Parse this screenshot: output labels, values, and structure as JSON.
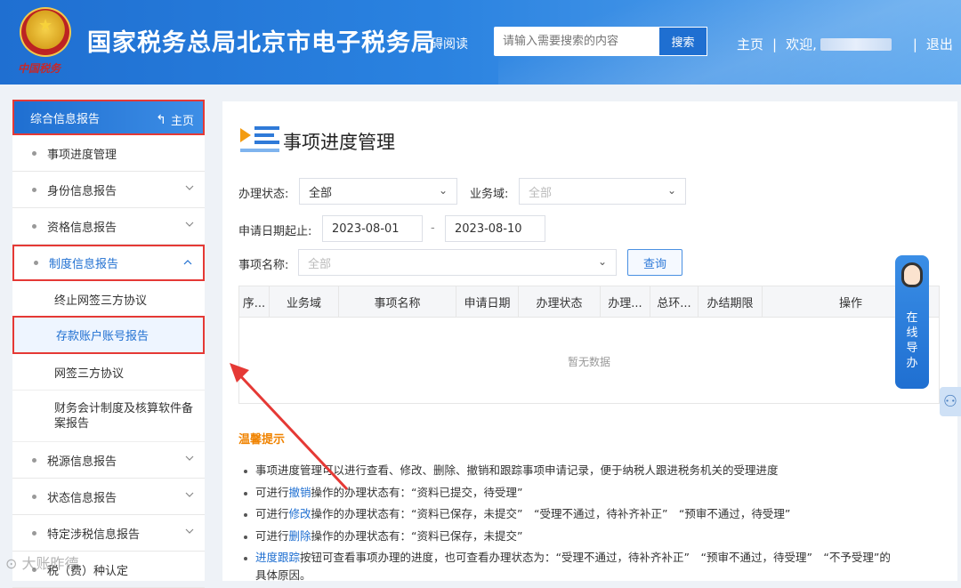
{
  "header": {
    "site_title": "国家税务总局北京市电子税务局",
    "emblem_caption": "中国税务",
    "accessibility": "碍阅读",
    "search_placeholder": "请输入需要搜索的内容",
    "search_button": "搜索",
    "nav_home": "主页",
    "sep1": "|",
    "nav_welcome": "欢迎,",
    "sep2": "|",
    "nav_logout": "退出"
  },
  "sidebar": {
    "top_label": "综合信息报告",
    "top_home": "主页",
    "items": [
      {
        "label": "事项进度管理"
      },
      {
        "label": "身份信息报告"
      },
      {
        "label": "资格信息报告"
      },
      {
        "label": "制度信息报告"
      },
      {
        "label": "税源信息报告"
      },
      {
        "label": "状态信息报告"
      },
      {
        "label": "特定涉税信息报告"
      },
      {
        "label": "税（费）种认定"
      }
    ],
    "sub_items": [
      {
        "label": "终止网签三方协议"
      },
      {
        "label": "存款账户账号报告"
      },
      {
        "label": "网签三方协议"
      },
      {
        "label": "财务会计制度及核算软件备案报告"
      }
    ]
  },
  "main": {
    "title": "事项进度管理",
    "status_label": "办理状态:",
    "status_value": "全部",
    "domain_label": "业务域:",
    "domain_placeholder": "全部",
    "date_label": "申请日期起止:",
    "date_start": "2023-08-01",
    "date_dash": "-",
    "date_end": "2023-08-10",
    "item_label": "事项名称:",
    "item_placeholder": "全部",
    "query_button": "查询",
    "table_headers": [
      "序...",
      "业务域",
      "事项名称",
      "申请日期",
      "办理状态",
      "办理...",
      "总环...",
      "办结期限",
      "操作"
    ],
    "empty_text": "暂无数据",
    "tips_title": "温馨提示",
    "tips": {
      "t1": "事项进度管理可以进行查看、修改、删除、撤销和跟踪事项申请记录，便于纳税人跟进税务机关的受理进度",
      "t2_pre": "可进行",
      "t2_link": "撤销",
      "t2_post": "操作的办理状态有：“资料已提交，待受理”",
      "t3_pre": "可进行",
      "t3_link": "修改",
      "t3_post": "操作的办理状态有：“资料已保存，未提交”　“受理不通过，待补齐补正”　“预审不通过，待受理”",
      "t4_pre": "可进行",
      "t4_link": "删除",
      "t4_post": "操作的办理状态有：“资料已保存，未提交”",
      "t5_link": "进度跟踪",
      "t5_post": "按钮可查看事项办理的进度，也可查看办理状态为：“受理不通过，待补齐补正”　“预审不通过，待受理”　“不予受理”的",
      "t5_cont": "具体原因。"
    }
  },
  "widget": {
    "label": "在线导办"
  },
  "watermark": "⊙ 大账昨德",
  "colors": {
    "accent": "#1f6fd1",
    "highlight_border": "#e53935",
    "tips_title": "#f08300"
  },
  "icons": [
    "emblem-icon",
    "search-icon",
    "home-back-icon",
    "chevron-down-icon",
    "chevron-up-icon",
    "list-icon",
    "customer-service-icon",
    "user-icon"
  ]
}
